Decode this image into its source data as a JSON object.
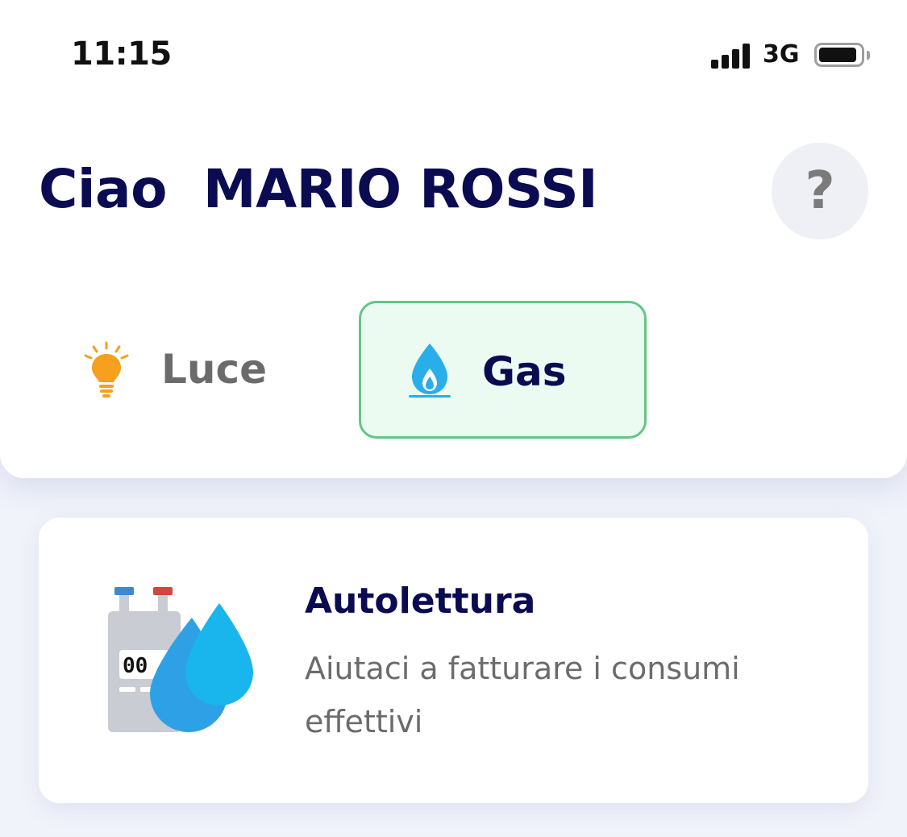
{
  "status_bar": {
    "time": "11:15",
    "network": "3G",
    "signal_bars": 4,
    "battery_level": 0.92
  },
  "header": {
    "greeting": "Ciao  MARIO ROSSI",
    "help_label": "?"
  },
  "tabs": [
    {
      "label": "Luce",
      "icon": "lightbulb-icon",
      "selected": false
    },
    {
      "label": "Gas",
      "icon": "gas-flame-icon",
      "selected": true
    }
  ],
  "cards": [
    {
      "title": "Autolettura",
      "description": "Aiutaci a fatturare i consumi effettivi",
      "icon": "gas-meter-icon",
      "meter_display": "00"
    }
  ],
  "colors": {
    "brand_navy": "#0b0b52",
    "selected_tab_bg": "#ebfbf1",
    "selected_tab_border": "#62c686",
    "bulb_orange": "#f5a01e",
    "flame_blue": "#29aee9",
    "muted_text": "#6b6b6b"
  }
}
